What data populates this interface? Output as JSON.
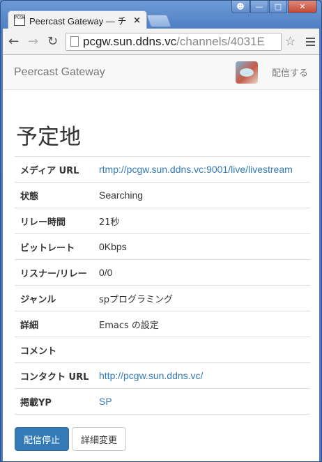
{
  "browser": {
    "tab_title": "Peercast Gateway — チ",
    "favicon_text": "PCGW",
    "url_host": "pcgw.sun.ddns.vc",
    "url_path": "/channels/4031E"
  },
  "navbar": {
    "brand": "Peercast Gateway",
    "broadcast_link": "配信する"
  },
  "channel": {
    "title": "予定地",
    "rows": [
      {
        "label": "メディア URL",
        "value": "rtmp://pcgw.sun.ddns.vc:9001/live/livestream",
        "link": true
      },
      {
        "label": "状態",
        "value": "Searching",
        "link": false
      },
      {
        "label": "リレー時間",
        "value": "21秒",
        "link": false
      },
      {
        "label": "ビットレート",
        "value": "0Kbps",
        "link": false
      },
      {
        "label": "リスナー/リレー",
        "value": "0/0",
        "link": false
      },
      {
        "label": "ジャンル",
        "value": "spプログラミング",
        "link": false
      },
      {
        "label": "詳細",
        "value": "Emacs の設定",
        "link": false
      },
      {
        "label": "コメント",
        "value": "",
        "link": false
      },
      {
        "label": "コンタクト URL",
        "value": "http://pcgw.sun.ddns.vc/",
        "link": true
      },
      {
        "label": "掲載YP",
        "value": "SP",
        "link": true
      }
    ]
  },
  "actions": {
    "stop_label": "配信停止",
    "edit_label": "詳細変更"
  },
  "colors": {
    "link": "#337ab7",
    "primary": "#337ab7"
  }
}
